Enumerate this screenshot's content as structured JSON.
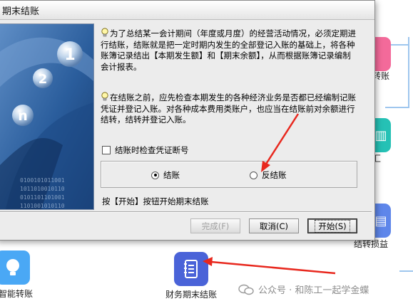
{
  "dialog": {
    "title": "期末结账",
    "para1": "为了总结某一会计期间（年度或月度）的经营活动情况，必须定期进行结账，结账就是把一定时期内发生的全部登记入账的基础上，将各种账簿记录结出【本期发生额】和【期末余额】，从而根据账簿记录编制会计报表。",
    "para2": "在结账之前，应先检查本期发生的各种经济业务是否都已经编制记账凭证并登记入账。对各种成本费用类账户，也应当在结账前对余额进行结转，结转并登记入账。",
    "checkbox_label": "结账时检查凭证断号",
    "checkbox_checked": false,
    "radio_close_label": "结账",
    "radio_unclose_label": "反结账",
    "selected_radio": "结账",
    "hint": "按【开始】按钮开始期末结账",
    "buttons": {
      "finish": "完成(F)",
      "cancel": "取消(C)",
      "start": "开始(S)"
    }
  },
  "background": {
    "labels": {
      "transfer": "转账",
      "summary": "汇",
      "profit_loss": "结转损益",
      "smart_transfer": "智能转账",
      "period_close": "财务期末结账"
    },
    "colors": {
      "pink": "#f36a9a",
      "teal": "#25c1b5",
      "blue": "#5e86ea",
      "light_blue": "#4aa8f5",
      "indigo": "#4a63d8"
    }
  },
  "art": {
    "numbers": [
      "1",
      "2",
      "n"
    ]
  },
  "watermark": {
    "text": "公众号 · 和陈工一起学金蝶"
  },
  "annotations": {
    "arrow_color": "#e8281e"
  }
}
